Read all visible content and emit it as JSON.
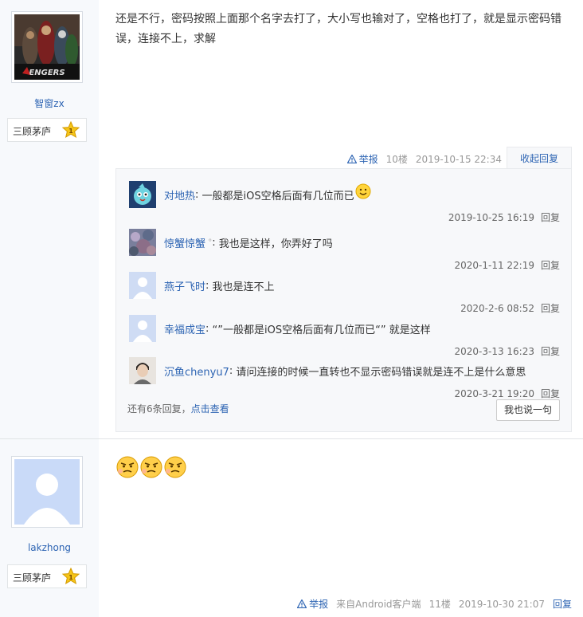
{
  "post1": {
    "author": "智窗zx",
    "level_name": "三顾茅庐",
    "level_num": "1",
    "text": "还是不行，密码按照上面那个名字去打了，大小写也输对了，空格也打了，就是显示密码错误，连接不上，求解",
    "tail": {
      "report": "举报",
      "floor": "10楼",
      "time": "2019-10-15 22:34",
      "collapse": "收起回复"
    },
    "replies": [
      {
        "user": "对地热",
        "text": "一般都是iOS空格后面有几位而已",
        "time": "2019-10-25 16:19",
        "reply": "回复",
        "emoji": "smile-emoji"
      },
      {
        "user": "惊蟹惊蟹",
        "text": "我也是这样，你弄好了吗",
        "time": "2020-1-11 22:19",
        "reply": "回复"
      },
      {
        "user": "燕子飞时",
        "text": "我也是连不上",
        "time": "2020-2-6 08:52",
        "reply": "回复"
      },
      {
        "user": "幸福成宝",
        "text": "“”一般都是iOS空格后面有几位而已“” 就是这样",
        "time": "2020-3-13 16:23",
        "reply": "回复"
      },
      {
        "user": "沉鱼chenyu7",
        "text": "请问连接的时候一直转也不显示密码错误就是连不上是什么意思",
        "time": "2020-3-21 19:20",
        "reply": "回复"
      }
    ],
    "more_prefix": "还有6条回复，",
    "more_link": "点击查看",
    "say_button": "我也说一句"
  },
  "post2": {
    "author": "lakzhong",
    "level_name": "三顾茅庐",
    "level_num": "1",
    "emojis": [
      "angry-emoji",
      "angry-emoji",
      "angry-emoji"
    ],
    "tail": {
      "report": "举报",
      "client": "来自Android客户端",
      "floor": "11楼",
      "time": "2019-10-30 21:07",
      "reply": "回复"
    }
  },
  "colors": {
    "link": "#2d64b3",
    "sidebar": "#f7f9fc",
    "badge": "#f5c518"
  }
}
